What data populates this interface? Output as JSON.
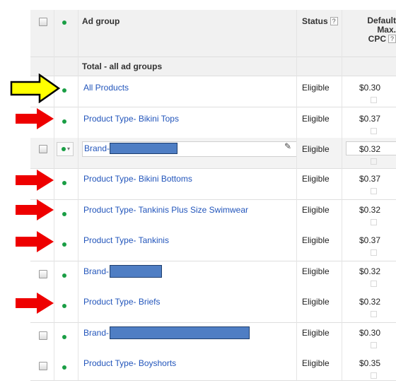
{
  "header": {
    "ad_group": "Ad group",
    "status": "Status",
    "status_help": "?",
    "cpc_line1": "Default",
    "cpc_line2": "Max.",
    "cpc_line3": "CPC",
    "cpc_help": "?"
  },
  "total_label": "Total - all ad groups",
  "rows": [
    {
      "name": "All Products",
      "status": "Eligible",
      "cpc": "$0.30"
    },
    {
      "name": "Product Type- Bikini Tops",
      "status": "Eligible",
      "cpc": "$0.37"
    },
    {
      "name": "Brand-",
      "status": "Eligible",
      "cpc": "$0.32"
    },
    {
      "name": "Product Type- Bikini Bottoms",
      "status": "Eligible",
      "cpc": "$0.37"
    },
    {
      "name": "Product Type- Tankinis Plus Size Swimwear",
      "status": "Eligible",
      "cpc": "$0.32"
    },
    {
      "name": "Product Type- Tankinis",
      "status": "Eligible",
      "cpc": "$0.37"
    },
    {
      "name": "Brand-",
      "status": "Eligible",
      "cpc": "$0.32"
    },
    {
      "name": "Product Type- Briefs",
      "status": "Eligible",
      "cpc": "$0.32"
    },
    {
      "name": "Brand-",
      "status": "Eligible",
      "cpc": "$0.30"
    },
    {
      "name": "Product Type- Boyshorts",
      "status": "Eligible",
      "cpc": "$0.35"
    }
  ],
  "colors": {
    "link": "#2255bb",
    "status_dot": "#1a9e45",
    "arrow_red": "#ee0000",
    "arrow_yellow": "#ffff00",
    "redaction": "#4f7ec4"
  }
}
